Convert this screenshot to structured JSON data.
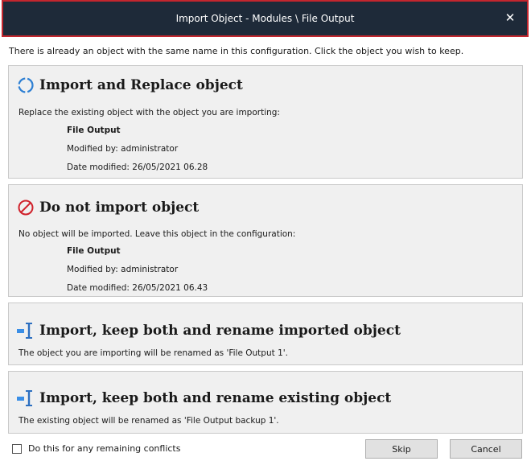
{
  "window": {
    "title": "Import Object - Modules \\ File Output",
    "close_glyph": "✕"
  },
  "intro_text": "There is already an object with the same name in this configuration. Click the object you wish to keep.",
  "options": [
    {
      "heading": "Import and Replace object",
      "icon": "replace-icon",
      "description": "Replace the existing object with the object you are importing:",
      "object_name": "File Output",
      "modified_by": "Modified by: administrator",
      "date_modified": "Date modified: 26/05/2021 06.28"
    },
    {
      "heading": "Do not import object",
      "icon": "do-not-import-icon",
      "description": "No object will be imported. Leave this object in the configuration:",
      "object_name": "File Output",
      "modified_by": "Modified by: administrator",
      "date_modified": "Date modified: 26/05/2021 06.43"
    },
    {
      "heading": "Import, keep both and rename imported object",
      "icon": "rename-icon",
      "description": "The object you are importing will be renamed as 'File Output 1'."
    },
    {
      "heading": "Import, keep both and rename existing object",
      "icon": "rename-icon",
      "description": "The existing object will be renamed as 'File Output backup 1'."
    }
  ],
  "footer": {
    "checkbox_label": "Do this for any remaining conflicts",
    "checkbox_checked": false,
    "skip_label": "Skip",
    "cancel_label": "Cancel"
  },
  "colors": {
    "title_bar": "#1e2a39",
    "title_bar_border": "#c4262e",
    "replace_icon": "#2d7fd3",
    "do_not_import_icon": "#d0212b",
    "rename_icon": "#3a8ee6"
  }
}
